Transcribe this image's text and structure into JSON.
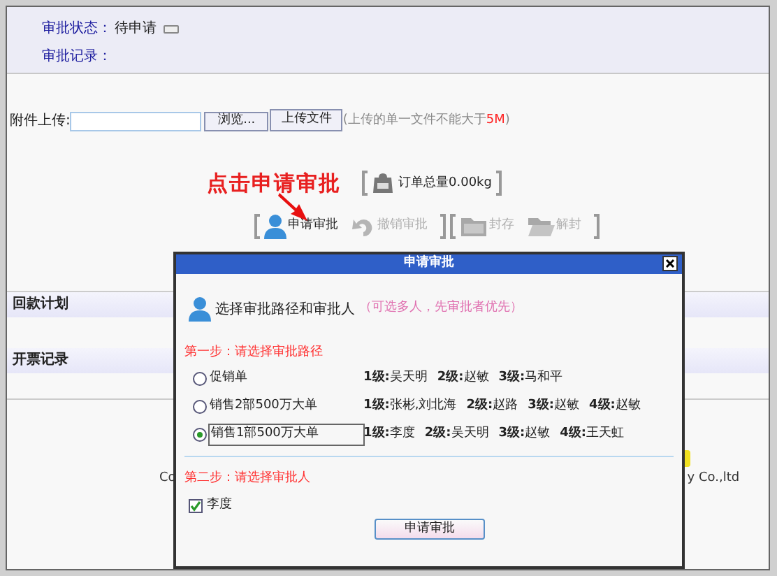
{
  "approval": {
    "status_label": "审批状态：",
    "status_value": "待申请",
    "record_label": "审批记录："
  },
  "upload": {
    "label": "附件上传:",
    "browse_button": "浏览...",
    "upload_button": "上传文件",
    "note_prefix": "(上传的单一文件不能大于",
    "note_limit": "5M",
    "note_suffix": ")"
  },
  "annotation": "点击申请审批",
  "order_weight": "订单总量0.00kg",
  "toolbar": [
    {
      "label": "申请审批",
      "kind": "apply",
      "disabled": false
    },
    {
      "label": "撤销审批",
      "kind": "revoke",
      "disabled": true
    },
    {
      "label": "封存",
      "kind": "seal",
      "disabled": true
    },
    {
      "label": "解封",
      "kind": "unseal",
      "disabled": true
    }
  ],
  "sections": [
    "回款计划",
    "开票记录"
  ],
  "footer": {
    "left_fragment": "Co",
    "right_fragment": "y Co.,ltd"
  },
  "dialog": {
    "title": "申请审批",
    "heading": "选择审批路径和审批人",
    "hint": "（可选多人，先审批者优先）",
    "step1": "第一步：请选择审批路径",
    "routes": [
      {
        "name": "促销单",
        "selected": false,
        "levels": [
          "**1级:**吴天明",
          "**2级:**赵敏",
          "**3级:**马和平"
        ]
      },
      {
        "name": "销售2部500万大单",
        "selected": false,
        "levels": [
          "**1级:**张彬,刘北海",
          "**2级:**赵路",
          "**3级:**赵敏",
          "**4级:**赵敏"
        ]
      },
      {
        "name": "销售1部500万大单",
        "selected": true,
        "levels": [
          "**1级:**李度",
          "**2级:**吴天明",
          "**3级:**赵敏",
          "**4级:**王天虹"
        ]
      }
    ],
    "step2": "第二步：请选择审批人",
    "approvers": [
      {
        "name": "李度",
        "checked": true
      }
    ],
    "submit": "申请审批"
  }
}
